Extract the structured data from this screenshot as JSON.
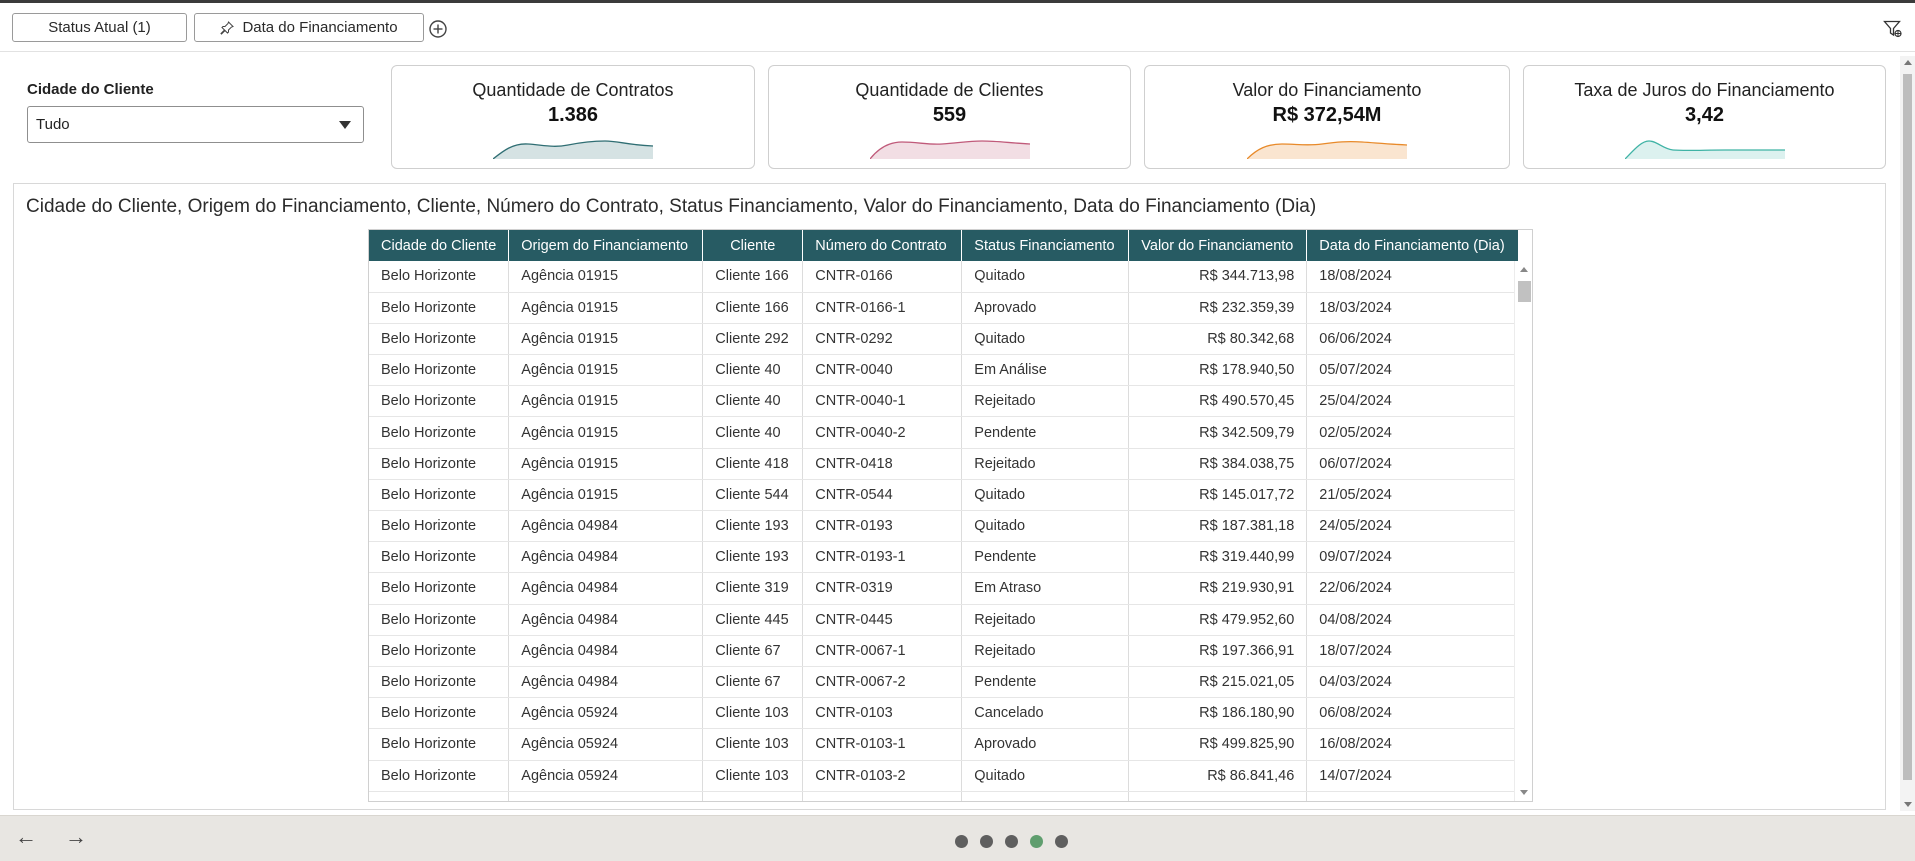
{
  "filter_bar": {
    "chips": [
      {
        "label": "Status Atual (1)",
        "pinned": false
      },
      {
        "label": "Data do Financiamento",
        "pinned": true
      }
    ]
  },
  "city_filter": {
    "label": "Cidade do Cliente",
    "value": "Tudo"
  },
  "kpis": [
    {
      "title": "Quantidade de Contratos",
      "value": "1.386",
      "color": "#2f6e73"
    },
    {
      "title": "Quantidade de Clientes",
      "value": "559",
      "color": "#c05a7a"
    },
    {
      "title": "Valor do Financiamento",
      "value": "R$ 372,54M",
      "color": "#e88a2a"
    },
    {
      "title": "Taxa de Juros do Financiamento",
      "value": "3,42",
      "color": "#3fb3a5"
    }
  ],
  "table_panel": {
    "title": "Cidade do Cliente, Origem do Financiamento, Cliente, Número do Contrato, Status Financiamento, Valor do Financiamento, Data do Financiamento (Dia)",
    "columns": [
      "Cidade do Cliente",
      "Origem do Financiamento",
      "Cliente",
      "Número do Contrato",
      "Status Financiamento",
      "Valor do Financiamento",
      "Data do Financiamento (Dia)"
    ],
    "rows": [
      [
        "Belo Horizonte",
        "Agência 01915",
        "Cliente 166",
        "CNTR-0166",
        "Quitado",
        "R$ 344.713,98",
        "18/08/2024"
      ],
      [
        "Belo Horizonte",
        "Agência 01915",
        "Cliente 166",
        "CNTR-0166-1",
        "Aprovado",
        "R$ 232.359,39",
        "18/03/2024"
      ],
      [
        "Belo Horizonte",
        "Agência 01915",
        "Cliente 292",
        "CNTR-0292",
        "Quitado",
        "R$ 80.342,68",
        "06/06/2024"
      ],
      [
        "Belo Horizonte",
        "Agência 01915",
        "Cliente 40",
        "CNTR-0040",
        "Em Análise",
        "R$ 178.940,50",
        "05/07/2024"
      ],
      [
        "Belo Horizonte",
        "Agência 01915",
        "Cliente 40",
        "CNTR-0040-1",
        "Rejeitado",
        "R$ 490.570,45",
        "25/04/2024"
      ],
      [
        "Belo Horizonte",
        "Agência 01915",
        "Cliente 40",
        "CNTR-0040-2",
        "Pendente",
        "R$ 342.509,79",
        "02/05/2024"
      ],
      [
        "Belo Horizonte",
        "Agência 01915",
        "Cliente 418",
        "CNTR-0418",
        "Rejeitado",
        "R$ 384.038,75",
        "06/07/2024"
      ],
      [
        "Belo Horizonte",
        "Agência 01915",
        "Cliente 544",
        "CNTR-0544",
        "Quitado",
        "R$ 145.017,72",
        "21/05/2024"
      ],
      [
        "Belo Horizonte",
        "Agência 04984",
        "Cliente 193",
        "CNTR-0193",
        "Quitado",
        "R$ 187.381,18",
        "24/05/2024"
      ],
      [
        "Belo Horizonte",
        "Agência 04984",
        "Cliente 193",
        "CNTR-0193-1",
        "Pendente",
        "R$ 319.440,99",
        "09/07/2024"
      ],
      [
        "Belo Horizonte",
        "Agência 04984",
        "Cliente 319",
        "CNTR-0319",
        "Em Atraso",
        "R$ 219.930,91",
        "22/06/2024"
      ],
      [
        "Belo Horizonte",
        "Agência 04984",
        "Cliente 445",
        "CNTR-0445",
        "Rejeitado",
        "R$ 479.952,60",
        "04/08/2024"
      ],
      [
        "Belo Horizonte",
        "Agência 04984",
        "Cliente 67",
        "CNTR-0067-1",
        "Rejeitado",
        "R$ 197.366,91",
        "18/07/2024"
      ],
      [
        "Belo Horizonte",
        "Agência 04984",
        "Cliente 67",
        "CNTR-0067-2",
        "Pendente",
        "R$ 215.021,05",
        "04/03/2024"
      ],
      [
        "Belo Horizonte",
        "Agência 05924",
        "Cliente 103",
        "CNTR-0103",
        "Cancelado",
        "R$ 186.180,90",
        "06/08/2024"
      ],
      [
        "Belo Horizonte",
        "Agência 05924",
        "Cliente 103",
        "CNTR-0103-1",
        "Aprovado",
        "R$ 499.825,90",
        "16/08/2024"
      ],
      [
        "Belo Horizonte",
        "Agência 05924",
        "Cliente 103",
        "CNTR-0103-2",
        "Quitado",
        "R$ 86.841,46",
        "14/07/2024"
      ]
    ]
  },
  "footer": {
    "prev_label": "←",
    "next_label": "→",
    "page_count": 5,
    "active_page": 4,
    "active_color": "#5f9e6e"
  },
  "colors": {
    "table_header": "#275b63"
  }
}
